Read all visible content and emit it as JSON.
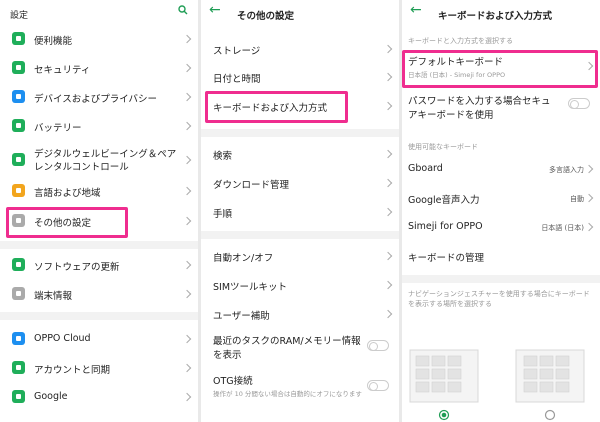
{
  "panel1": {
    "title": "設定",
    "items": [
      {
        "label": "便利機能",
        "color": "#1fae5a"
      },
      {
        "label": "セキュリティ",
        "color": "#1fae5a"
      },
      {
        "label": "デバイスおよびプライバシー",
        "color": "#1d8ff0"
      },
      {
        "label": "バッテリー",
        "color": "#1fae5a"
      },
      {
        "label_line1": "デジタルウェルビーイング＆ペア",
        "label_line2": "レンタルコントロール",
        "color": "#1fae5a"
      },
      {
        "label": "言語および地域",
        "color": "#f2a51d"
      },
      {
        "label": "その他の設定",
        "color": "#aaaaaa"
      },
      {
        "label": "ソフトウェアの更新",
        "color": "#1fae5a"
      },
      {
        "label": "端末情報",
        "color": "#aaaaaa"
      },
      {
        "label": "OPPO Cloud",
        "color": "#1d8ff0"
      },
      {
        "label": "アカウントと同期",
        "color": "#1fae5a"
      },
      {
        "label": "Google",
        "color": "#1fae5a"
      }
    ]
  },
  "panel2": {
    "title": "その他の設定",
    "items": [
      {
        "label": "ストレージ"
      },
      {
        "label": "日付と時間"
      },
      {
        "label": "キーボードおよび入力方式"
      },
      {
        "label": "検索"
      },
      {
        "label": "ダウンロード管理"
      },
      {
        "label": "手順"
      },
      {
        "label": "自動オン/オフ"
      },
      {
        "label": "SIMツールキット"
      },
      {
        "label": "ユーザー補助"
      },
      {
        "label_line1": "最近のタスクのRAM/メモリー情報",
        "label_line2": "を表示"
      },
      {
        "label": "OTG接続",
        "sub": "操作が 10 分間ない場合は自動的にオフになります"
      }
    ]
  },
  "panel3": {
    "title": "キーボードおよび入力方式",
    "section1": "キーボードと入力方式を選択する",
    "default_kb": {
      "label": "デフォルトキーボード",
      "sub": "日本語 (日本) - Simeji for OPPO"
    },
    "password_line1": "パスワードを入力する場合セキュ",
    "password_line2": "アキーボードを使用",
    "section2": "使用可能なキーボード",
    "keyboards": [
      {
        "label": "Gboard",
        "value": "多言語入力"
      },
      {
        "label": "Google音声入力",
        "value": "自動"
      },
      {
        "label": "Simeji for OPPO",
        "value": "日本語 (日本)"
      }
    ],
    "manage": "キーボードの管理",
    "nav_hint_line1": "ナビゲーションジェスチャーを使用する場合にキーボード",
    "nav_hint_line2": "を表示する場所を選択する",
    "accent": "#1f9d55"
  }
}
